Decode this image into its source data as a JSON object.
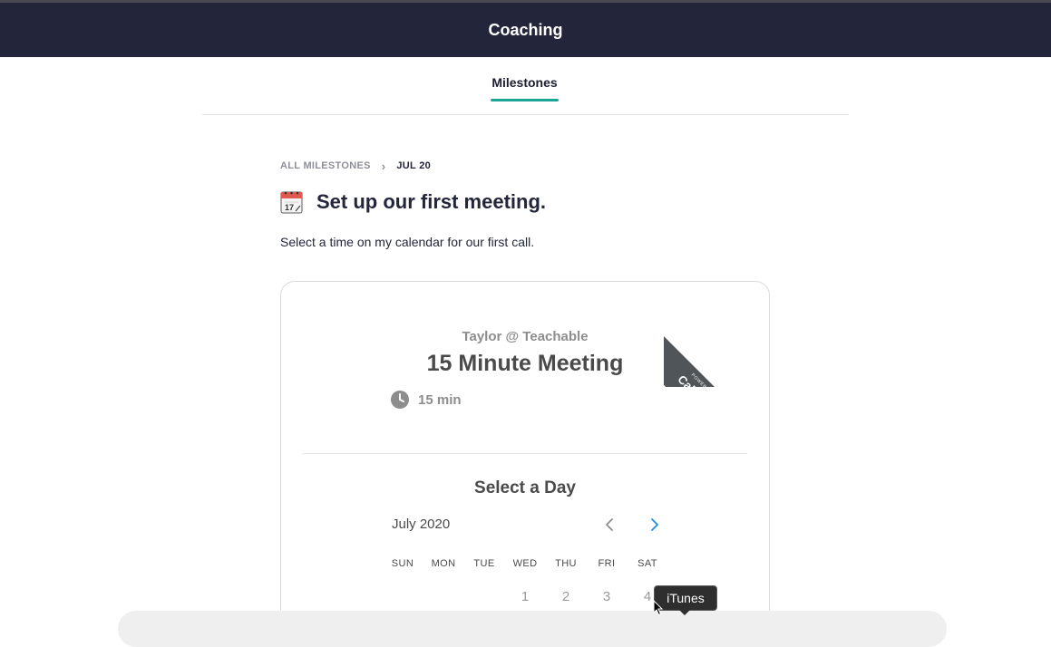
{
  "header": {
    "title": "Coaching"
  },
  "tabs": [
    {
      "label": "Milestones",
      "active": true
    }
  ],
  "breadcrumb": {
    "all_label": "ALL MILESTONES",
    "current_label": "JUL 20"
  },
  "milestone": {
    "icon": "calendar-icon",
    "title": "Set up our first meeting.",
    "description": "Select a time on my calendar for our first call."
  },
  "calendly": {
    "ribbon_small": "POWERED BY",
    "ribbon_brand": "Calendly",
    "host": "Taylor @ Teachable",
    "meeting_name": "15 Minute Meeting",
    "duration": "15 min",
    "select_day_heading": "Select a Day",
    "month": "July 2020",
    "weekdays": [
      "SUN",
      "MON",
      "TUE",
      "WED",
      "THU",
      "FRI",
      "SAT"
    ],
    "first_week": [
      "",
      "",
      "",
      "1",
      "2",
      "3",
      "4"
    ]
  },
  "tooltip": {
    "text": "iTunes"
  },
  "colors": {
    "header_bg": "#23263b",
    "tab_accent": "#1ea497",
    "ribbon_bg": "#4f5559",
    "nav_next": "#1a8fe0"
  }
}
